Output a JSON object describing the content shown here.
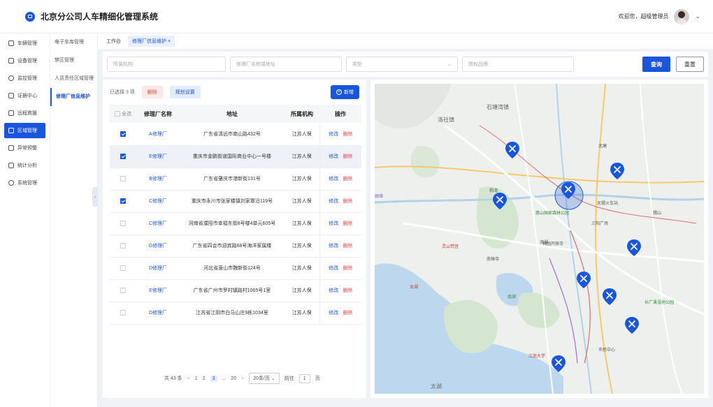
{
  "header": {
    "title": "北京分公司人车精细化管理系统",
    "welcome": "欢迎您，超级管理员"
  },
  "sidebar": {
    "items": [
      {
        "label": "车辆管理",
        "icon": "car-icon"
      },
      {
        "label": "设备管理",
        "icon": "device-icon"
      },
      {
        "label": "监控管理",
        "icon": "monitor-icon"
      },
      {
        "label": "证据中心",
        "icon": "evidence-icon"
      },
      {
        "label": "远程救援",
        "icon": "rescue-icon"
      },
      {
        "label": "区域管理",
        "icon": "region-icon",
        "active": true
      },
      {
        "label": "异常预警",
        "icon": "warning-icon"
      },
      {
        "label": "统计分析",
        "icon": "chart-icon"
      },
      {
        "label": "系统管理",
        "icon": "settings-icon"
      }
    ]
  },
  "submenu": {
    "items": [
      {
        "label": "电子车库管理"
      },
      {
        "label": "禁区管理"
      },
      {
        "label": "人员责任区域管理"
      },
      {
        "label": "修理厂信息维护",
        "active": true
      }
    ]
  },
  "tabs": [
    {
      "label": "工作台"
    },
    {
      "label": "修理厂信息维护 ×",
      "active": true
    }
  ],
  "filters": {
    "org_placeholder": "所属机构",
    "name_placeholder": "修理厂名称或地址",
    "type_placeholder": "类型",
    "brand_placeholder": "授权品牌",
    "query_label": "查询",
    "reset_label": "重置"
  },
  "table_panel": {
    "selected_text": "已选择 3 项",
    "delete_label": "删除",
    "plan_label": "规划设置",
    "new_label": "新增",
    "columns": [
      "全选",
      "修理厂名称",
      "地址",
      "所属机构",
      "操作"
    ],
    "edit_label": "修改",
    "del_label": "删除",
    "rows": [
      {
        "name": "A修理厂",
        "address": "广东省清远市南山路432号",
        "org": "江苏人保",
        "checked": true,
        "hl": false
      },
      {
        "name": "E修理厂",
        "address": "重庆市金鹏街道国际商业中心一号楼",
        "org": "江苏人保",
        "checked": true,
        "hl": true
      },
      {
        "name": "B修理厂",
        "address": "广东省肇庆市港新街131号",
        "org": "江苏人保",
        "checked": false,
        "hl": false
      },
      {
        "name": "C修理厂",
        "address": "重庆市永川市张家楼镇刘家寨沿119号",
        "org": "江苏人保",
        "checked": true,
        "hl": false
      },
      {
        "name": "C修理厂",
        "address": "河南省濮阳市幸福东街8号楼4单元605号",
        "org": "江苏人保",
        "checked": false,
        "hl": false
      },
      {
        "name": "G修理厂",
        "address": "广东省四会市迎宾路68号海洋家属楼",
        "org": "江苏人保",
        "checked": false,
        "hl": false
      },
      {
        "name": "D修理厂",
        "address": "河北省唐山市魏新街124号",
        "org": "江苏人保",
        "checked": false,
        "hl": false
      },
      {
        "name": "E修理厂",
        "address": "广东省广州市罗村镇路村1065号1室",
        "org": "江苏人保",
        "checked": false,
        "hl": false
      },
      {
        "name": "D修理厂",
        "address": "江苏省江阴市白马山庄9栋1034室",
        "org": "江苏人保",
        "checked": false,
        "hl": false
      }
    ],
    "pager": {
      "total": "共 43 条",
      "prev": "<",
      "pages": [
        "1",
        "2",
        "3",
        "...",
        "20"
      ],
      "current": "3",
      "next": ">",
      "page_size": "20条/页",
      "goto_prefix": "前往",
      "goto_value": "1",
      "goto_suffix": "页"
    }
  },
  "map": {
    "labels": [
      "石塘湾镇",
      "洛社镇",
      "杨湾",
      "无锡火车站",
      "锡山",
      "三阳广场",
      "滨湖",
      "南禅寺",
      "惠山国家森林公园",
      "蠡湖",
      "太湖",
      "灵山梵宫",
      "长广溪湿地公园",
      "梅园开原寺",
      "市民中心",
      "江南大学",
      "北塘",
      "胡埭",
      "太湖"
    ],
    "accent": "#1a56db"
  }
}
